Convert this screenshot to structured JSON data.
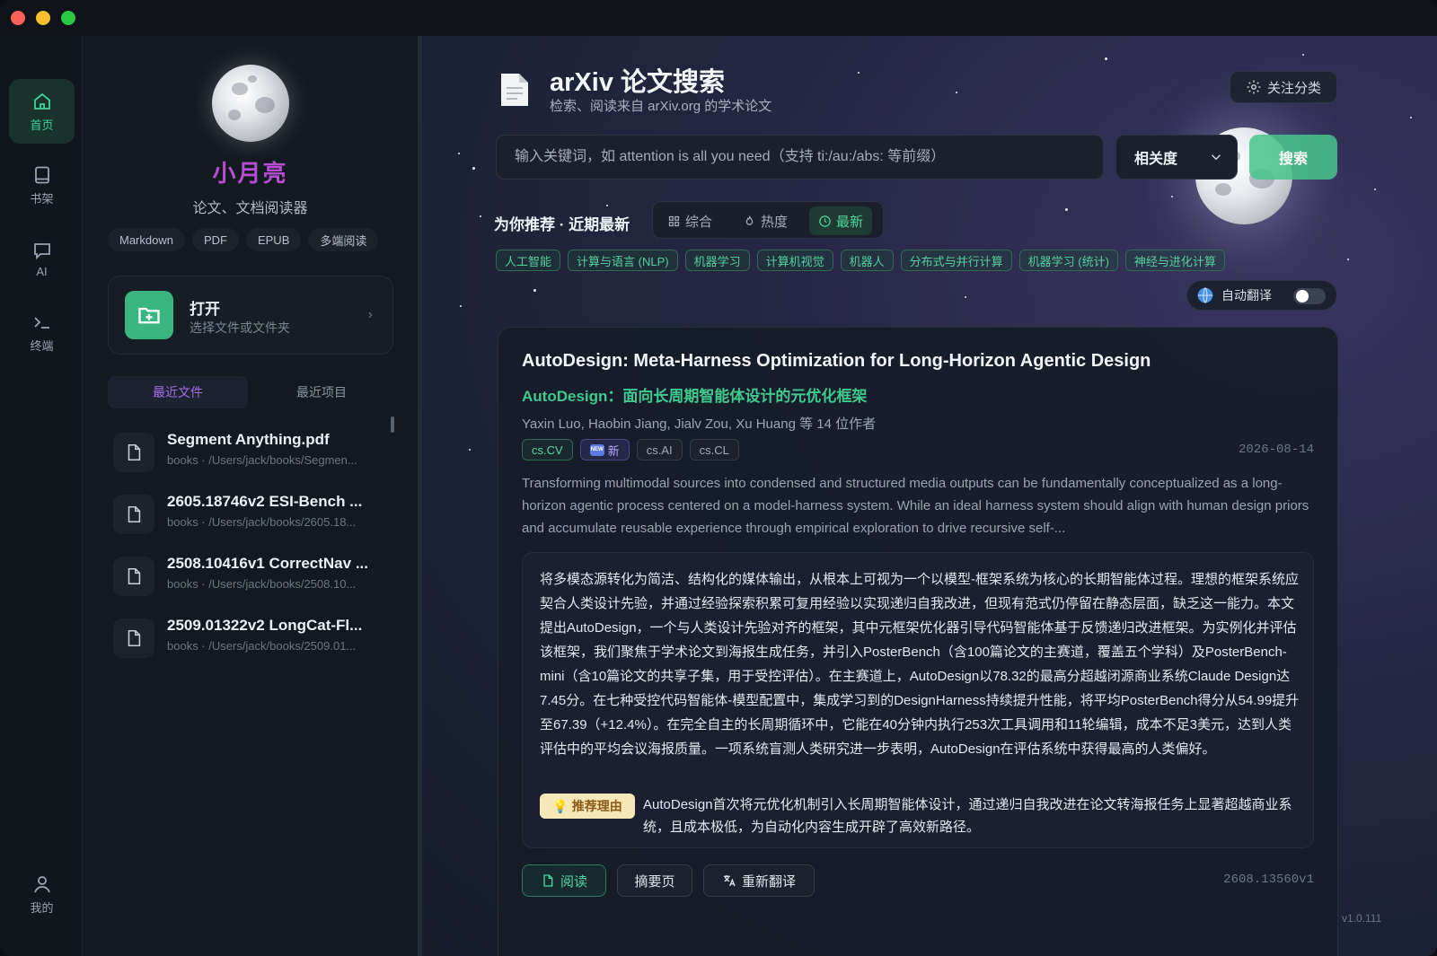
{
  "rail": {
    "items": [
      {
        "label": "首页",
        "icon": "home-icon"
      },
      {
        "label": "书架",
        "icon": "book-icon"
      },
      {
        "label": "AI",
        "icon": "chat-icon"
      },
      {
        "label": "终端",
        "icon": "terminal-icon"
      }
    ],
    "bottom": {
      "label": "我的",
      "icon": "user-icon"
    }
  },
  "sidebar": {
    "app_name": "小月亮",
    "app_sub": "论文、文档阅读器",
    "formats": [
      "Markdown",
      "PDF",
      "EPUB",
      "多端阅读"
    ],
    "open_card": {
      "title": "打开",
      "subtitle": "选择文件或文件夹"
    },
    "tabs": [
      "最近文件",
      "最近项目"
    ],
    "files": [
      {
        "name": "Segment Anything.pdf",
        "path": "books · /Users/jack/books/Segmen..."
      },
      {
        "name": "2605.18746v2 ESI-Bench ...",
        "path": "books · /Users/jack/books/2605.18..."
      },
      {
        "name": "2508.10416v1 CorrectNav ...",
        "path": "books · /Users/jack/books/2508.10..."
      },
      {
        "name": "2509.01322v2 LongCat-Fl...",
        "path": "books · /Users/jack/books/2509.01..."
      }
    ]
  },
  "main": {
    "title": "arXiv 论文搜索",
    "subtitle": "检索、阅读来自 arXiv.org 的学术论文",
    "follow_label": "关注分类",
    "search_placeholder": "输入关键词，如 attention is all you need（支持 ti:/au:/abs: 等前缀）",
    "sort_label": "相关度",
    "search_label": "搜索",
    "rec_title": "为你推荐 · 近期最新",
    "segments": [
      "综合",
      "热度",
      "最新"
    ],
    "categories": [
      "人工智能",
      "计算与语言 (NLP)",
      "机器学习",
      "计算机视觉",
      "机器人",
      "分布式与并行计算",
      "机器学习 (统计)",
      "神经与进化计算"
    ],
    "auto_translate_label": "自动翻译",
    "version": "v1.0.111"
  },
  "paper": {
    "title": "AutoDesign: Meta-Harness Optimization for Long-Horizon Agentic Design",
    "cn_title": "AutoDesign：面向长周期智能体设计的元优化框架",
    "authors": "Yaxin Luo, Haobin Jiang, Jialv Zou, Xu Huang 等 14 位作者",
    "tags": {
      "primary": "cs.CV",
      "new_label": "新",
      "new_badge": "NEW",
      "others": [
        "cs.AI",
        "cs.CL"
      ]
    },
    "date": "2026-08-14",
    "abstract_en": "Transforming multimodal sources into condensed and structured media outputs can be fundamentally conceptualized as a long-horizon agentic process centered on a model-harness system. While an ideal harness system should align with human design priors and accumulate reusable experience through empirical exploration to drive recursive self-...",
    "abstract_cn": "将多模态源转化为简洁、结构化的媒体输出，从根本上可视为一个以模型-框架系统为核心的长期智能体过程。理想的框架系统应契合人类设计先验，并通过经验探索积累可复用经验以实现递归自我改进，但现有范式仍停留在静态层面，缺乏这一能力。本文提出AutoDesign，一个与人类设计先验对齐的框架，其中元框架优化器引导代码智能体基于反馈递归改进框架。为实例化并评估该框架，我们聚焦于学术论文到海报生成任务，并引入PosterBench（含100篇论文的主赛道，覆盖五个学科）及PosterBench-mini（含10篇论文的共享子集，用于受控评估）。在主赛道上，AutoDesign以78.32的最高分超越闭源商业系统Claude Design达7.45分。在七种受控代码智能体-模型配置中，集成学习到的DesignHarness持续提升性能，将平均PosterBench得分从54.99提升至67.39（+12.4%）。在完全自主的长周期循环中，它能在40分钟内执行253次工具调用和11轮编辑，成本不足3美元，达到人类评估中的平均会议海报质量。一项系统盲测人类研究进一步表明，AutoDesign在评估系统中获得最高的人类偏好。",
    "reason_label": "推荐理由",
    "reason_text": "AutoDesign首次将元优化机制引入长周期智能体设计，通过递归自我改进在论文转海报任务上显著超越商业系统，且成本极低，为自动化内容生成开辟了高效新路径。",
    "actions": {
      "read": "阅读",
      "abstract_page": "摘要页",
      "retranslate": "重新翻译"
    },
    "id": "2608.13560v1"
  },
  "colors": {
    "accent_green": "#43d39a",
    "accent_purple": "#b54fd0",
    "reason_bg": "#f6e7b8"
  }
}
